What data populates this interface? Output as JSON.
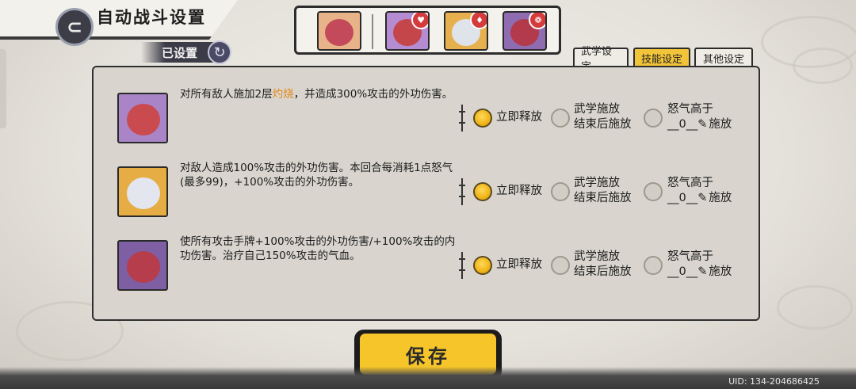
{
  "header": {
    "title": "自动战斗设置",
    "title_icon": "back-emblem-icon"
  },
  "status": {
    "label": "已设置",
    "icon": "refresh-icon"
  },
  "team": {
    "heroes": [
      {
        "name": "hero-leader-pink-hair",
        "tag": ""
      },
      {
        "name": "hero-lion-dance",
        "tag": "♥"
      },
      {
        "name": "hero-white-fox-mask",
        "tag": "♦"
      },
      {
        "name": "hero-red-mask-warlord",
        "tag": "❁"
      }
    ]
  },
  "tabs": [
    {
      "label": "武学设定",
      "active": false
    },
    {
      "label": "技能设定",
      "active": true
    },
    {
      "label": "其他设定",
      "active": false
    }
  ],
  "skills": [
    {
      "desc_pre": "对所有敌人施加2层",
      "desc_hl": "灼烧",
      "desc_post": "，并造成300%攻击的外功伤害。",
      "selected": "立即释放"
    },
    {
      "desc_pre": "对敌人造成100%攻击的外功伤害。本回合每消耗1点怒气(最多99)，+100%攻击的外功伤害。",
      "desc_hl": "",
      "desc_post": "",
      "selected": "立即释放"
    },
    {
      "desc_pre": "使所有攻击手牌+100%攻击的外功伤害/+100%攻击的内功伤害。治疗自己150%攻击的气血。",
      "desc_hl": "",
      "desc_post": "",
      "selected": "立即释放"
    }
  ],
  "options": {
    "immediate": "立即释放",
    "after_line1": "武学施放",
    "after_line2": "结束后施放",
    "rage_line1": "怒气高于",
    "rage_value": "__0__",
    "rage_line2": "施放"
  },
  "save_button": "保存",
  "uid": "UID: 134-204686425",
  "colors": {
    "accent": "#f5c52a",
    "highlight": "#e38718",
    "panel": "#d9d5ce"
  }
}
